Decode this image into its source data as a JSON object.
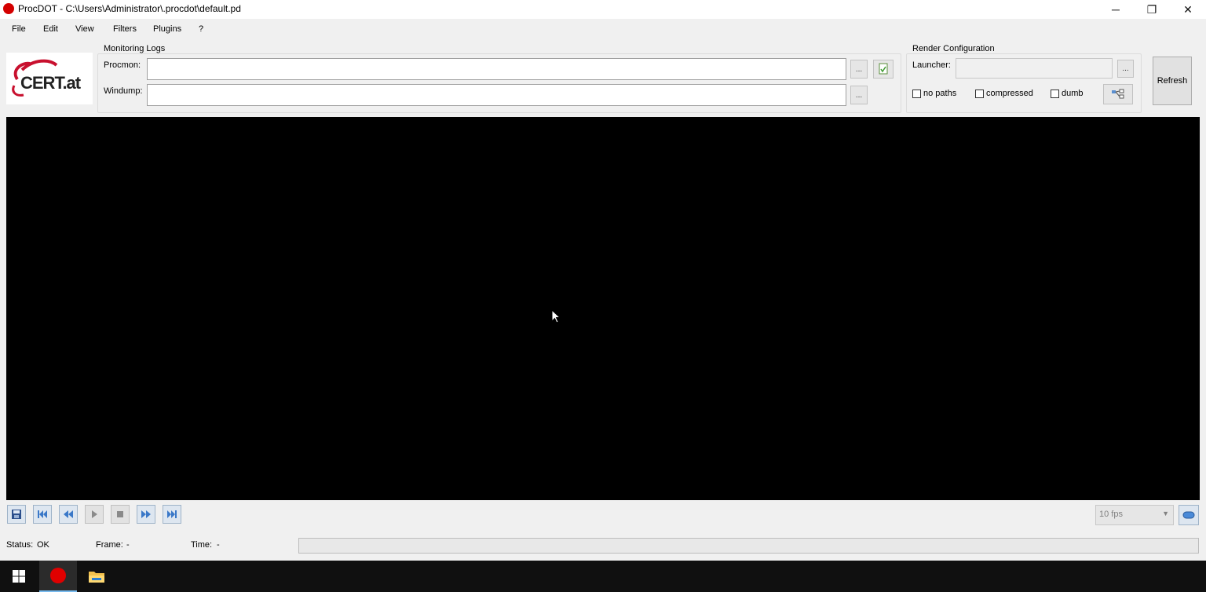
{
  "window": {
    "title": "ProcDOT - C:\\Users\\Administrator\\.procdot\\default.pd",
    "app_icon": "procdot-red-dot-icon",
    "controls": {
      "minimize": "─",
      "maximize": "❐",
      "close": "✕"
    }
  },
  "menu": [
    "File",
    "Edit",
    "View",
    "Filters",
    "Plugins",
    "?"
  ],
  "logo": {
    "text": "CERT.at",
    "accent_color": "#c8102e"
  },
  "monitoring_logs": {
    "title": "Monitoring Logs",
    "procmon_label": "Procmon:",
    "procmon_value": "",
    "windump_label": "Windump:",
    "windump_value": "",
    "browse_label": "..."
  },
  "render_config": {
    "title": "Render Configuration",
    "launcher_label": "Launcher:",
    "launcher_value": "",
    "browse_label": "...",
    "checkboxes": [
      {
        "label": "no paths",
        "checked": false
      },
      {
        "label": "compressed",
        "checked": false
      },
      {
        "label": "dumb",
        "checked": false
      }
    ]
  },
  "refresh_label": "Refresh",
  "playback": {
    "buttons": [
      "save-icon",
      "skip-to-start-icon",
      "rewind-icon",
      "play-icon",
      "stop-icon",
      "fast-forward-icon",
      "skip-to-end-icon"
    ],
    "fps_value": "10 fps",
    "loop_icon": "loop-icon"
  },
  "status": {
    "status_label": "Status:",
    "status_value": "OK",
    "frame_label": "Frame:",
    "frame_value": "-",
    "time_label": "Time:",
    "time_value": "-"
  },
  "taskbar": [
    "windows-start-icon",
    "procdot-icon",
    "file-explorer-icon"
  ],
  "colors": {
    "canvas": "#000000",
    "taskbar": "#101010",
    "accent": "#76b9ed"
  }
}
